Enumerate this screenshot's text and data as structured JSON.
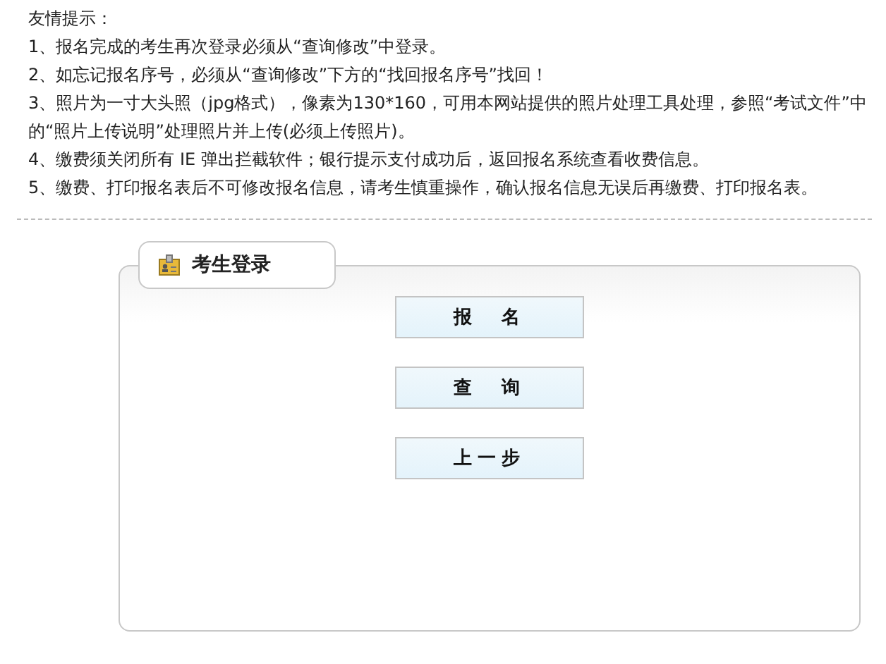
{
  "notice": {
    "title": "友情提示：",
    "items": [
      "1、报名完成的考生再次登录必须从“查询修改”中登录。",
      "2、如忘记报名序号，必须从“查询修改”下方的“找回报名序号”找回！",
      "3、照片为一寸大头照（jpg格式），像素为130*160，可用本网站提供的照片处理工具处理，参照“考试文件”中的“照片上传说明”处理照片并上传(必须上传照片)。",
      "4、缴费须关闭所有 IE 弹出拦截软件；银行提示支付成功后，返回报名系统查看收费信息。",
      "5、缴费、打印报名表后不可修改报名信息，请考生慎重操作，确认报名信息无误后再缴费、打印报名表。"
    ]
  },
  "login_panel": {
    "title": "考生登录",
    "buttons": [
      "报　名",
      "查　询",
      "上一步"
    ]
  }
}
